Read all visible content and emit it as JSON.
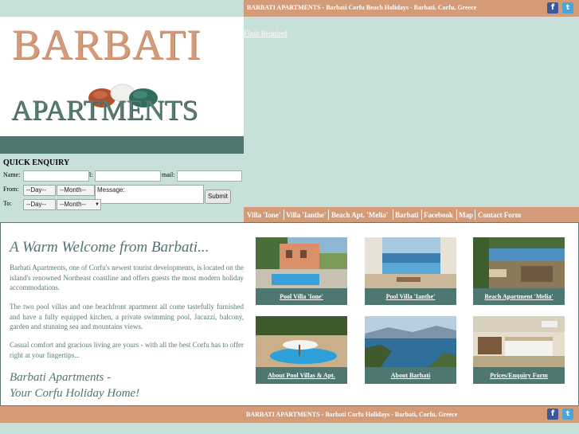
{
  "header": {
    "title": "BARBATI APARTMENTS - Barbati Corfu Beach Holidays - Barbati, Corfu, Greece",
    "social": [
      {
        "icon": "facebook-icon",
        "glyph": "f"
      },
      {
        "icon": "twitter-icon",
        "glyph": "t"
      }
    ]
  },
  "logo": {
    "line1": "BARBATI",
    "line2": "APARTMENTS"
  },
  "flash_notice": "Flash Required",
  "quick_enquiry": {
    "title": "QUICK ENQUIRY",
    "name_label": "Name:",
    "tel_label": "l:",
    "email_label": "mail:",
    "from_label": "From:",
    "to_label": "To:",
    "day_select": "--Day--",
    "month_select": "--Month--",
    "message_placeholder": "Message:",
    "submit_label": "Submit"
  },
  "nav": {
    "items": [
      "Villa 'Ione'",
      "Villa 'Ianthe'",
      "Beach Apt. 'Melia'",
      "Barbati",
      "Facebook",
      "Map",
      "Contact Form"
    ]
  },
  "main": {
    "heading": "A Warm Welcome from Barbati...",
    "paragraphs": [
      "Barbati Apartments, one of Corfu's newest tourist developments, is located on the island's renowned Northeast coastline and offers guests the most modern holiday accommodations.",
      "The two pool villas and one beachfront apartment all come tastefully furnished and have a fully equipped kitchen, a private swimming pool, Jacuzzi, balcony, garden and stunning sea and mountains views.",
      "Casual comfort and gracious living are yours - with all the best Corfu has to offer right at your fingertips..."
    ],
    "tagline_line1": "Barbati Apartments -",
    "tagline_line2": "Your Corfu Holiday Home!",
    "gallery": [
      {
        "caption": "Pool Villa 'Ione'"
      },
      {
        "caption": "Pool Villa 'Ianthe'"
      },
      {
        "caption": "Beach Apartment 'Melia'"
      },
      {
        "caption": "About Pool Villas & Apt."
      },
      {
        "caption": "About Barbati"
      },
      {
        "caption": "Prices/Enquiry Form"
      }
    ]
  },
  "footer": {
    "title": "BARBATI APARTMENTS - Barbati Corfu Holidays - Barbati, Corfu, Greece"
  },
  "colors": {
    "page_bg": "#c8e0da",
    "accent_bar": "#d49b78",
    "teal": "#4f7772",
    "facebook": "#3b5998",
    "twitter": "#4aa6d8"
  }
}
